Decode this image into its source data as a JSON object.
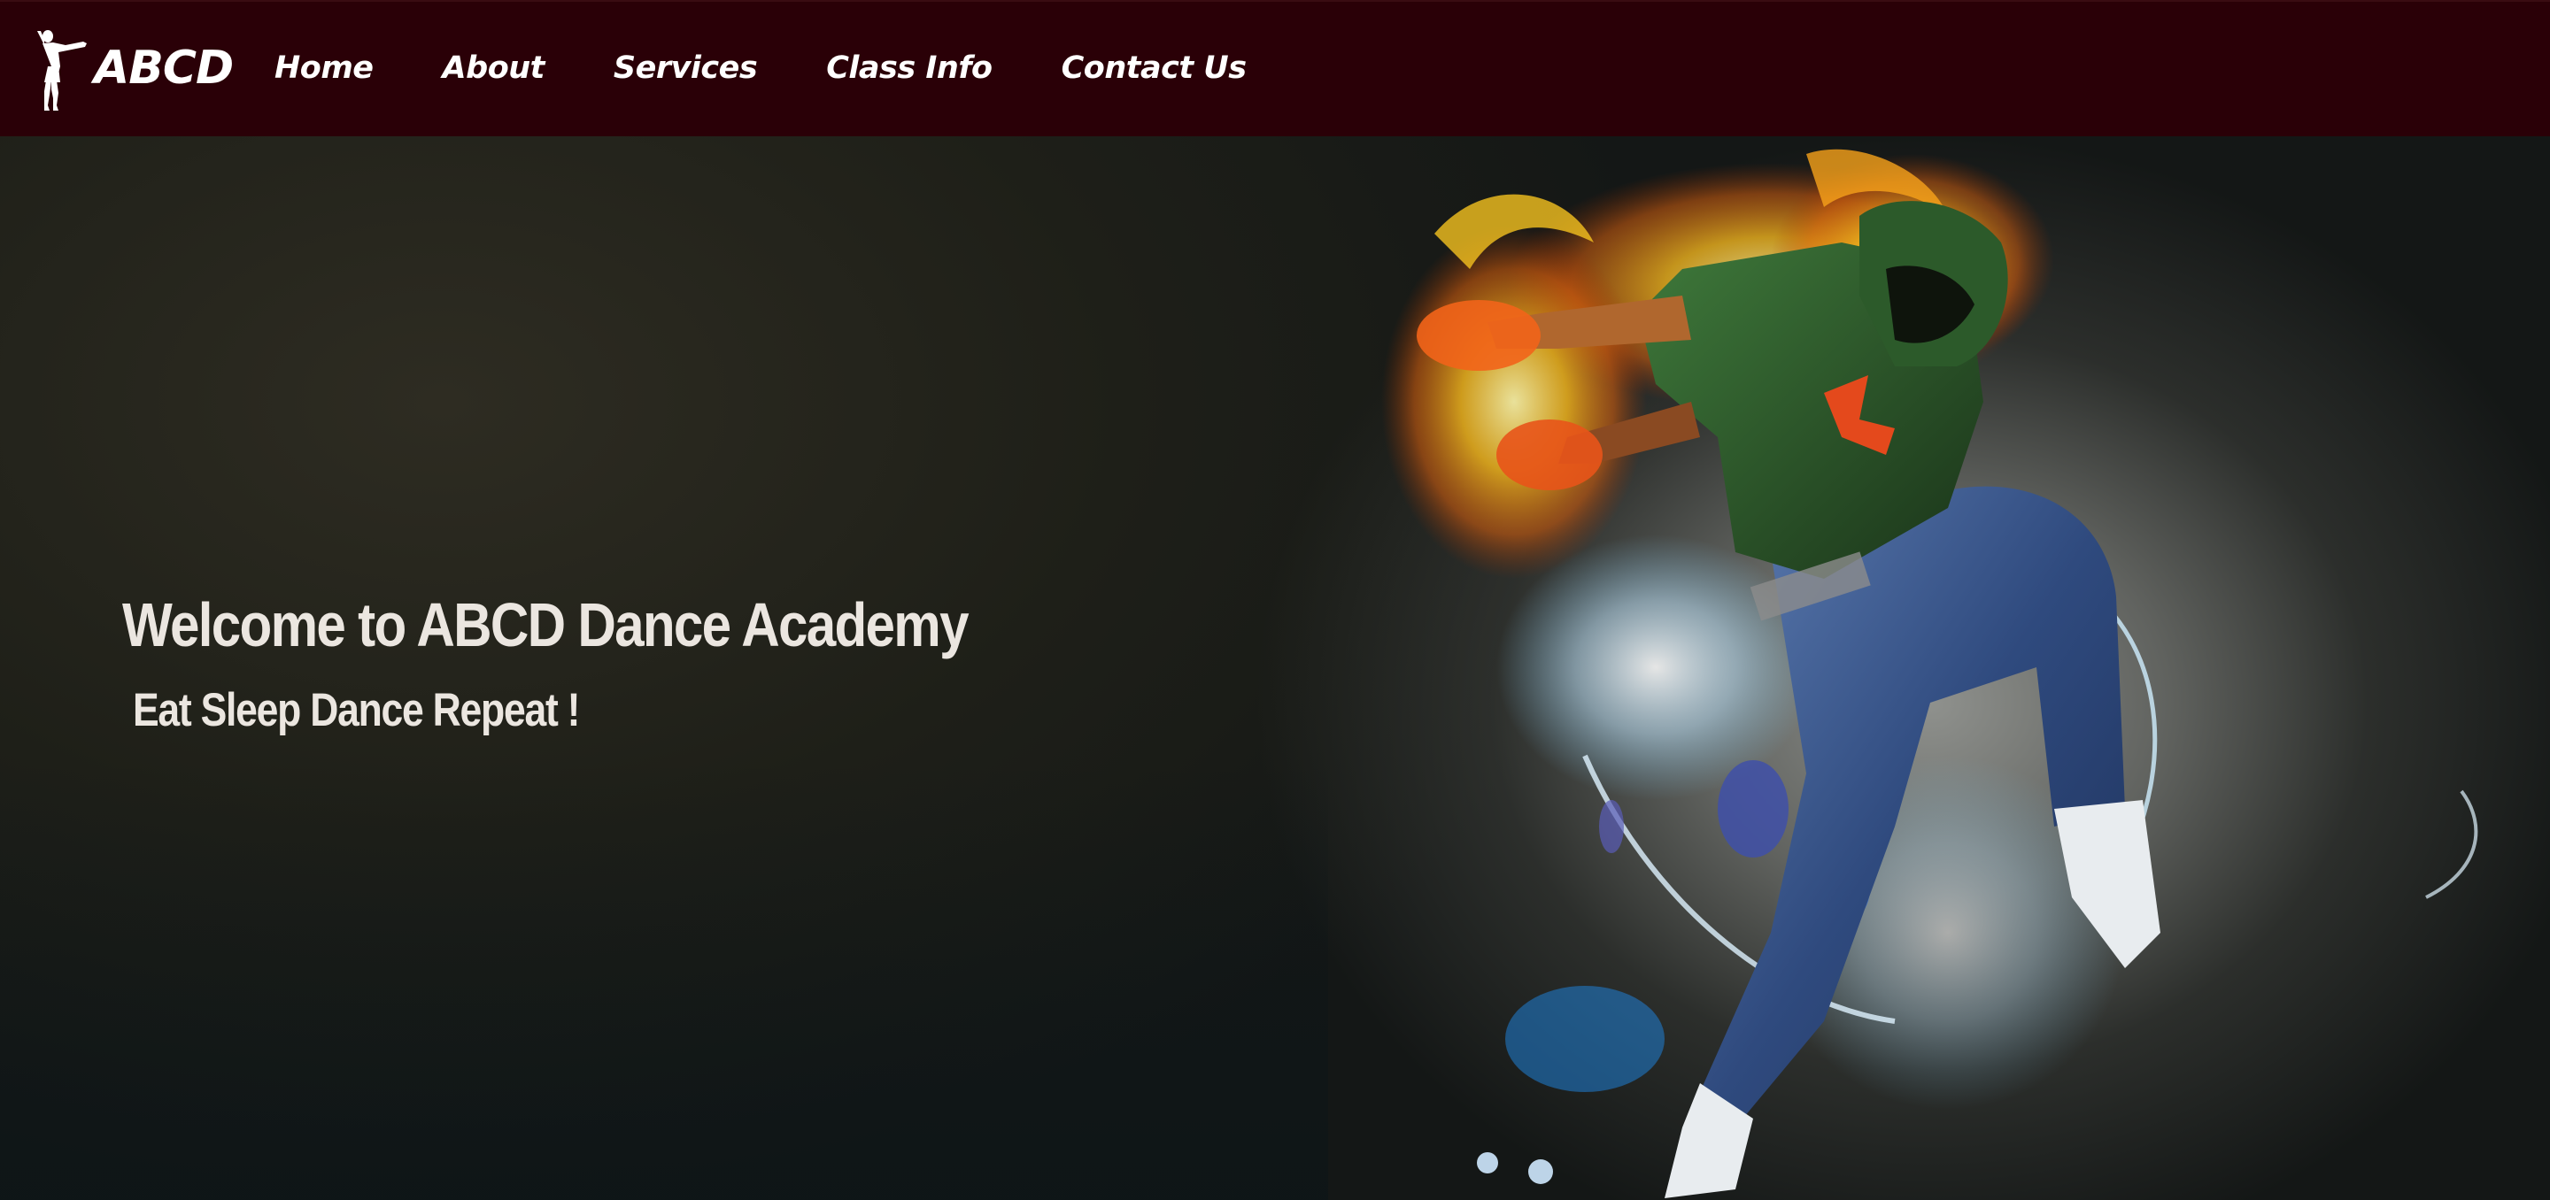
{
  "brand": {
    "name": "ABCD",
    "logo_icon": "dancer-silhouette-icon"
  },
  "nav": {
    "items": [
      {
        "label": "Home"
      },
      {
        "label": "About"
      },
      {
        "label": "Services"
      },
      {
        "label": "Class Info"
      },
      {
        "label": "Contact Us"
      }
    ]
  },
  "hero": {
    "title": "Welcome to ABCD Dance Academy",
    "subtitle": "Eat Sleep Dance Repeat !",
    "image": "hip-hop-dancer-with-fire-and-light-effects"
  },
  "colors": {
    "navbar_bg": "#2a0007",
    "nav_text": "#ffffff",
    "hero_text": "#ebe6e0"
  }
}
